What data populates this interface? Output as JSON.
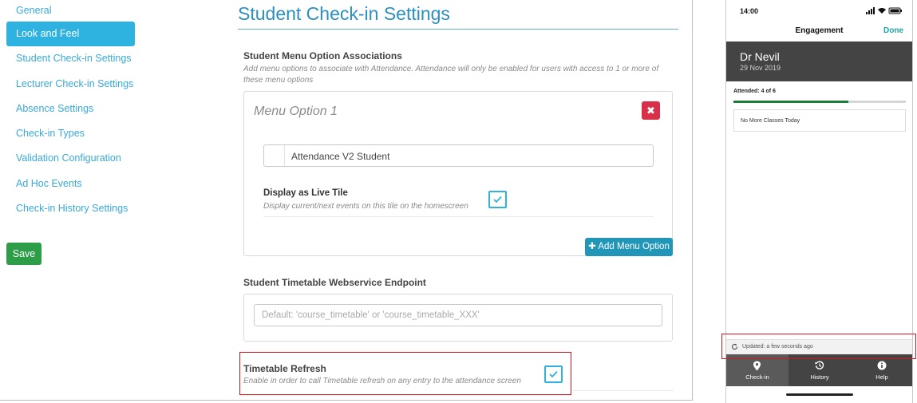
{
  "sidebar": {
    "items": [
      {
        "label": "General",
        "active": false
      },
      {
        "label": "Look and Feel",
        "active": true
      },
      {
        "label": "Student Check-in Settings",
        "active": false
      },
      {
        "label": "Lecturer Check-in Settings",
        "active": false
      },
      {
        "label": "Absence Settings",
        "active": false
      },
      {
        "label": "Check-in Types",
        "active": false
      },
      {
        "label": "Validation Configuration",
        "active": false
      },
      {
        "label": "Ad Hoc Events",
        "active": false
      },
      {
        "label": "Check-in History Settings",
        "active": false
      }
    ],
    "save_label": "Save"
  },
  "main": {
    "page_title": "Student Check-in Settings",
    "menu_associations": {
      "title": "Student Menu Option Associations",
      "help": "Add menu options to associate with Attendance. Attendance will only be enabled for users with access to 1 or more of these menu options",
      "option_header": "Menu Option 1",
      "remove_icon": "close-icon",
      "selected_value": "Attendance V2 Student",
      "live_tile_title": "Display as Live Tile",
      "live_tile_help": "Display current/next events on this tile on the homescreen",
      "live_tile_checked": true,
      "add_button_label": "Add Menu Option"
    },
    "timetable_endpoint": {
      "title": "Student Timetable Webservice Endpoint",
      "value": "",
      "placeholder": "Default: 'course_timetable' or 'course_timetable_XXX'"
    },
    "timetable_refresh": {
      "title": "Timetable Refresh",
      "help": "Enable in order to call Timetable refresh on any entry to the attendance screen",
      "checked": true
    }
  },
  "phone": {
    "status_time": "14:00",
    "nav_title": "Engagement",
    "nav_done": "Done",
    "person_name": "Dr Nevil",
    "person_date": "29 Nov 2019",
    "attended_label": "Attended: 4 of 6",
    "attended_fraction": 0.6667,
    "classes_text": "No More Classes Today",
    "updated_text": "Updated: a few seconds ago",
    "tabs": [
      {
        "label": "Check-in",
        "icon": "location-pin-icon",
        "active": true
      },
      {
        "label": "History",
        "icon": "history-icon",
        "active": false
      },
      {
        "label": "Help",
        "icon": "info-icon",
        "active": false
      }
    ]
  },
  "colors": {
    "accent": "#2eb2e0",
    "link": "#39a9d6",
    "save": "#2d9e47",
    "danger": "#d9304a",
    "header_dark": "#444444",
    "progress": "#1e7d38",
    "highlight": "#d9151b",
    "done_teal": "#1ea4a8"
  }
}
